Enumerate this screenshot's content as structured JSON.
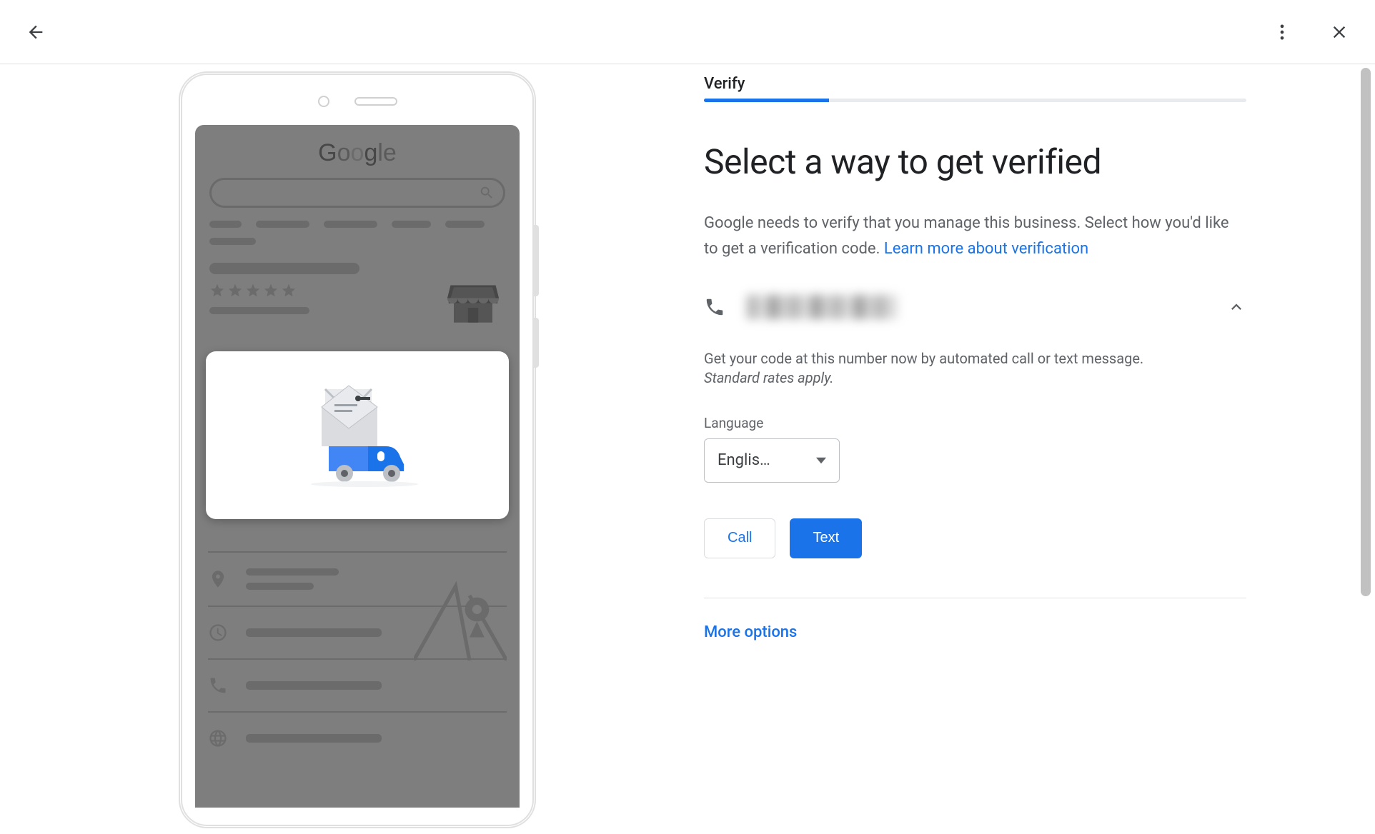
{
  "header": {
    "back_icon": "back-arrow",
    "more_icon": "more-vert",
    "close_icon": "close"
  },
  "step": {
    "label": "Verify",
    "progress_pct": 23
  },
  "heading": "Select a way to get verified",
  "description": "Google needs to verify that you manage this business. Select how you'd like to get a verification code. ",
  "description_link": "Learn more about verification",
  "phone_option": {
    "body_line1": "Get your code at this number now by automated call or text message.",
    "body_line2": "Standard rates apply.",
    "language_label": "Language",
    "language_value": "Englis…",
    "call_button": "Call",
    "text_button": "Text"
  },
  "more_options": "More options",
  "illustration": {
    "brand": "Google"
  }
}
